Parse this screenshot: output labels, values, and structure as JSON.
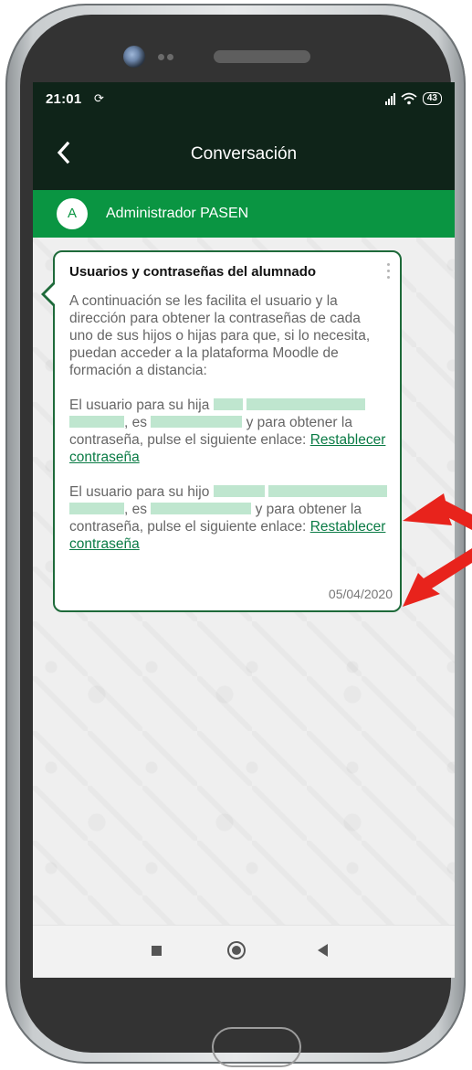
{
  "status_bar": {
    "time": "21:01",
    "notification_icon": "sync-icon",
    "battery": "43"
  },
  "app_bar": {
    "title": "Conversación",
    "back_icon": "back-arrow-icon"
  },
  "sender": {
    "avatar_letter": "A",
    "name": "Administrador PASEN"
  },
  "message": {
    "title": "Usuarios y contraseñas del alumnado",
    "intro": "A continuación se les facilita el usuario y la dirección para obtener la contraseñas de cada uno de sus hijos o hijas para que, si lo necesita, puedan acceder a la plataforma Moodle de formación a distancia:",
    "entries": [
      {
        "prefix": "El usuario para su hija",
        "mid": ", es",
        "suffix": "y para obtener la contraseña, pulse el siguiente enlace:",
        "link": "Restablecer contraseña"
      },
      {
        "prefix": "El usuario para su hijo",
        "mid": ", es",
        "suffix": "y para obtener la contraseña, pulse el siguiente enlace:",
        "link": "Restablecer contraseña"
      }
    ],
    "date": "05/04/2020"
  },
  "colors": {
    "dark_bar": "#0f2419",
    "sender_bar": "#0a9542",
    "bubble_border": "#1e6a3a",
    "link": "#0a7b45",
    "annotation_arrow": "#e8231c"
  }
}
